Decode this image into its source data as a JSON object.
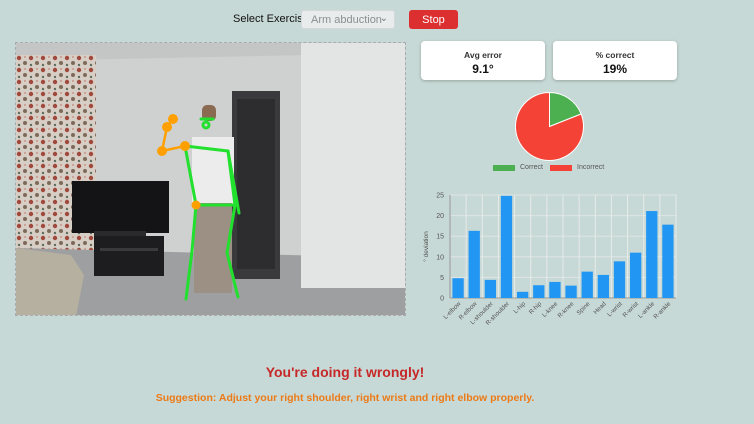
{
  "controls": {
    "select_label": "Select Exercise:",
    "selected_exercise": "Arm abduction",
    "stop_label": "Stop"
  },
  "stats": {
    "avg_error_title": "Avg error",
    "avg_error_value": "9.1°",
    "pct_correct_title": "% correct",
    "pct_correct_value": "19%"
  },
  "chart_data": [
    {
      "type": "pie",
      "labels": [
        "Correct",
        "Incorrect"
      ],
      "values": [
        19,
        81
      ],
      "colors": [
        "#4caf50",
        "#f44336"
      ],
      "legend_position": "bottom"
    },
    {
      "type": "bar",
      "categories": [
        "L-elbow",
        "R-elbow",
        "L-shoulder",
        "R-shoulder",
        "L-hip",
        "R-hip",
        "L-knee",
        "R-knee",
        "Spine",
        "Head",
        "L-wrist",
        "R-wrist",
        "L-ankle",
        "R-ankle"
      ],
      "values": [
        4.8,
        16.3,
        4.4,
        24.8,
        1.5,
        3.1,
        3.9,
        3.0,
        6.4,
        5.6,
        8.9,
        11.0,
        21.1,
        17.8
      ],
      "ylabel": "° deviation",
      "ylim": [
        0,
        25
      ],
      "yticks": [
        0,
        5,
        10,
        15,
        20,
        25
      ],
      "grid": true,
      "color": "#2196f3"
    }
  ],
  "feedback": {
    "message": "You're doing it wrongly!",
    "suggestion": "Suggestion: Adjust your right shoulder, right wrist and right elbow properly."
  }
}
